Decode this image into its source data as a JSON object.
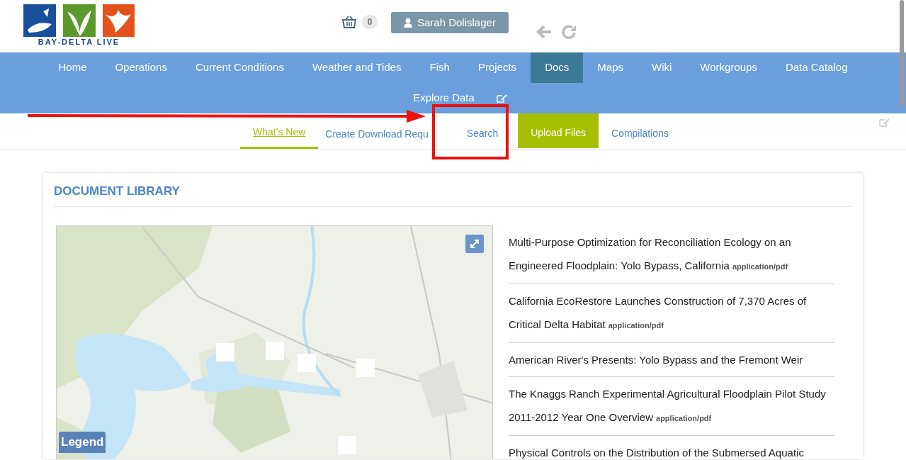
{
  "header": {
    "logo_text": "BAY-DELTA LIVE",
    "cart_count": "0",
    "user_button": "Sarah Dolislager"
  },
  "nav": {
    "items": [
      {
        "label": "Home",
        "selected": false
      },
      {
        "label": "Operations",
        "selected": false
      },
      {
        "label": "Current Conditions",
        "selected": false
      },
      {
        "label": "Weather and Tides",
        "selected": false
      },
      {
        "label": "Fish",
        "selected": false
      },
      {
        "label": "Projects",
        "selected": false
      },
      {
        "label": "Docs",
        "selected": true
      },
      {
        "label": "Maps",
        "selected": false
      },
      {
        "label": "Wiki",
        "selected": false
      },
      {
        "label": "Workgroups",
        "selected": false
      },
      {
        "label": "Data Catalog",
        "selected": false
      },
      {
        "label": "Explore Data",
        "selected": false
      }
    ]
  },
  "subtabs": [
    {
      "label": "What's New",
      "selected": true,
      "kind": "link"
    },
    {
      "label": "Create Download Requ",
      "selected": false,
      "kind": "link"
    },
    {
      "label": "Search",
      "selected": false,
      "kind": "link"
    },
    {
      "label": "Upload Files",
      "selected": false,
      "kind": "button"
    },
    {
      "label": "Compilations",
      "selected": false,
      "kind": "link"
    }
  ],
  "library": {
    "title": "DOCUMENT LIBRARY",
    "map": {
      "kind": "picture",
      "legend_button": "Legend"
    },
    "documents": [
      {
        "title": "Multi-Purpose Optimization for Reconciliation Ecology on an Engineered Floodplain: Yolo Bypass, California",
        "type": "application/pdf"
      },
      {
        "title": "California EcoRestore Launches Construction of 7,370 Acres of Critical Delta Habitat",
        "type": "application/pdf"
      },
      {
        "title": "American River's Presents: Yolo Bypass and the Fremont Weir"
      },
      {
        "title": "The Knaggs Ranch Experimental Agricultural Floodplain Pilot Study 2011-2012 Year One Overview",
        "type": "application/pdf"
      },
      {
        "title": "Physical Controls on the Distribution of the Submersed Aquatic"
      }
    ]
  }
}
